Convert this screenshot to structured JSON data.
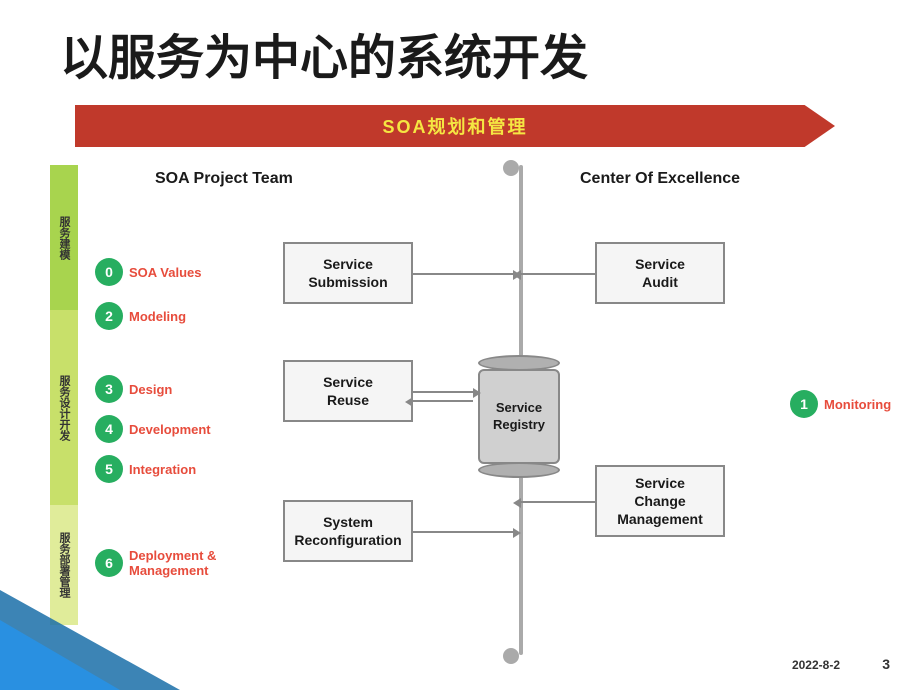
{
  "title": "以服务为中心的系统开发",
  "soa_banner": "SOA规划和管理",
  "col_left": "SOA Project Team",
  "col_right": "Center Of Excellence",
  "sidebar": {
    "top": "服务建模",
    "mid": "服务设计开发",
    "bot": "服务部署管理"
  },
  "soa_items": [
    {
      "num": "0",
      "label": "SOA Values"
    },
    {
      "num": "2",
      "label": "Modeling"
    },
    {
      "num": "3",
      "label": "Design"
    },
    {
      "num": "4",
      "label": "Development"
    },
    {
      "num": "5",
      "label": "Integration"
    },
    {
      "num": "6",
      "label": "Deployment &\nManagement"
    }
  ],
  "boxes": {
    "service_submission": "Service\nSubmission",
    "service_reuse": "Service\nReuse",
    "system_reconfig": "System\nReconfiguration",
    "service_audit": "Service\nAudit",
    "service_change": "Service\nChange\nManagement",
    "service_registry": "Service\nRegistry"
  },
  "monitoring": {
    "num": "1",
    "label": "Monitoring"
  },
  "footer": {
    "date": "2022-8-2",
    "page": "3"
  }
}
